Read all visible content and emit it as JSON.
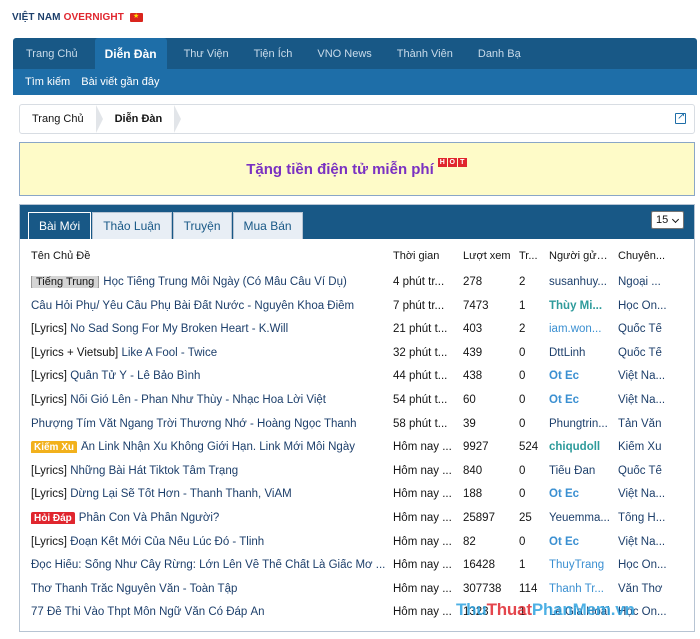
{
  "logo": {
    "part1": "VIỆT NAM",
    "part2": "OVERNIGHT",
    "flag_icon": "vietnam-flag-icon"
  },
  "nav": {
    "tabs": [
      "Trang Chủ",
      "Diễn Đàn",
      "Thư Viện",
      "Tiện Ích",
      "VNO News",
      "Thành Viên",
      "Danh Bạ"
    ],
    "active": "Diễn Đàn",
    "sub": [
      "Tìm kiếm",
      "Bài viết gần đây"
    ]
  },
  "breadcrumb": [
    "Trang Chủ",
    "Diễn Đàn"
  ],
  "promo": {
    "text": "Tặng tiền điện tử miễn phí",
    "badge": [
      "H",
      "O",
      "T"
    ]
  },
  "panel": {
    "tabs": [
      "Bài Mới",
      "Thảo Luận",
      "Truyện",
      "Mua Bán"
    ],
    "active_tab": "Bài Mới",
    "per_page": "15",
    "headers": {
      "title": "Tên Chủ Đề",
      "time": "Thời gian",
      "views": "Lượt xem",
      "replies": "Tr...",
      "poster": "Người gửi ...",
      "forum": "Chuyên..."
    },
    "rows": [
      {
        "prefix": "Tiếng Trung",
        "prefix_style": "gray",
        "title": "Học Tiếng Trung Mỗi Ngày (Có Mẫu Câu Ví Dụ)",
        "time": "4 phút tr...",
        "views": "278",
        "replies": "2",
        "poster": "susanhuy...",
        "poster_style": "normal",
        "forum": "Ngoại ..."
      },
      {
        "prefix": "",
        "prefix_style": "",
        "title": "Câu Hỏi Phụ/ Yêu Cầu Phụ Bài Đất Nước - Nguyễn Khoa Điềm",
        "time": "7 phút tr...",
        "views": "7473",
        "replies": "1",
        "poster": "Thùy Mi...",
        "poster_style": "strong",
        "forum": "Học On..."
      },
      {
        "prefix": "[Lyrics]",
        "prefix_style": "plain",
        "title": "No Sad Song For My Broken Heart - K.Will",
        "time": "21 phút t...",
        "views": "403",
        "replies": "2",
        "poster": "iam.won...",
        "poster_style": "light",
        "forum": "Quốc Tế"
      },
      {
        "prefix": "[Lyrics + Vietsub]",
        "prefix_style": "plain",
        "title": "Like A Fool - Twice",
        "time": "32 phút t...",
        "views": "439",
        "replies": "0",
        "poster": "DttLinh",
        "poster_style": "normal",
        "forum": "Quốc Tế"
      },
      {
        "prefix": "[Lyrics]",
        "prefix_style": "plain",
        "title": "Quân Tử Ý - Lê Bảo Bình",
        "time": "44 phút t...",
        "views": "438",
        "replies": "0",
        "poster": "Ốt Éc",
        "poster_style": "blue",
        "forum": "Việt Na..."
      },
      {
        "prefix": "[Lyrics]",
        "prefix_style": "plain",
        "title": "Nổi Gió Lên - Phan Như Thùy - Nhạc Hoa Lời Việt",
        "time": "54 phút t...",
        "views": "60",
        "replies": "0",
        "poster": "Ốt Éc",
        "poster_style": "blue",
        "forum": "Việt Na..."
      },
      {
        "prefix": "",
        "prefix_style": "",
        "title": "Phượng Tím Vắt Ngang Trời Thương Nhớ - Hoàng Ngọc Thanh",
        "time": "58 phút t...",
        "views": "39",
        "replies": "0",
        "poster": "Phungtrin...",
        "poster_style": "normal",
        "forum": "Tản Văn"
      },
      {
        "prefix": "Kiếm Xu",
        "prefix_style": "yellow",
        "title": "Ấn Link Nhận Xu Không Giới Hạn. Link Mới Mỗi Ngày",
        "time": "Hôm nay ...",
        "views": "9927",
        "replies": "524",
        "poster": "chiqudoll",
        "poster_style": "strong",
        "forum": "Kiếm Xu"
      },
      {
        "prefix": "[Lyrics]",
        "prefix_style": "plain",
        "title": "Những Bài Hát Tiktok Tâm Trạng",
        "time": "Hôm nay ...",
        "views": "840",
        "replies": "0",
        "poster": "Tiểu Đan",
        "poster_style": "normal",
        "forum": "Quốc Tế"
      },
      {
        "prefix": "[Lyrics]",
        "prefix_style": "plain",
        "title": "Dừng Lại Sẽ Tốt Hơn - Thanh Thanh, ViAM",
        "time": "Hôm nay ...",
        "views": "188",
        "replies": "0",
        "poster": "Ốt Éc",
        "poster_style": "blue",
        "forum": "Việt Na..."
      },
      {
        "prefix": "Hỏi Đáp",
        "prefix_style": "red",
        "title": "Phần Con Và Phần Người?",
        "time": "Hôm nay ...",
        "views": "25897",
        "replies": "25",
        "poster": "Yeuemma...",
        "poster_style": "normal",
        "forum": "Tổng H..."
      },
      {
        "prefix": "[Lyrics]",
        "prefix_style": "plain",
        "title": "Đoạn Kết Mới Của Nếu Lúc Đó - Tlinh",
        "time": "Hôm nay ...",
        "views": "82",
        "replies": "0",
        "poster": "Ốt Éc",
        "poster_style": "blue",
        "forum": "Việt Na..."
      },
      {
        "prefix": "",
        "prefix_style": "",
        "title": "Đọc Hiểu: Sống Như Cây Rừng: Lớn Lên Về Thể Chất Là Giấc Mơ ...",
        "time": "Hôm nay ...",
        "views": "16428",
        "replies": "1",
        "poster": "ThuyTrang",
        "poster_style": "light",
        "forum": "Học On..."
      },
      {
        "prefix": "",
        "prefix_style": "",
        "title": "Thơ Thanh Trắc Nguyễn Văn - Toàn Tập",
        "time": "Hôm nay ...",
        "views": "307738",
        "replies": "114",
        "poster": "Thanh Tr...",
        "poster_style": "light",
        "forum": "Văn Thơ"
      },
      {
        "prefix": "",
        "prefix_style": "",
        "title": "77 Đề Thi Vào Thpt Môn Ngữ Văn Có Đáp Án",
        "time": "Hôm nay ...",
        "views": "1323",
        "replies": "1",
        "poster": "Lê Gia Hoài",
        "poster_style": "normal",
        "forum": "Học On..."
      }
    ]
  },
  "watermark": {
    "part1": "Thu",
    "part2": "Thuat",
    "part3": "PhanMem.vn"
  }
}
